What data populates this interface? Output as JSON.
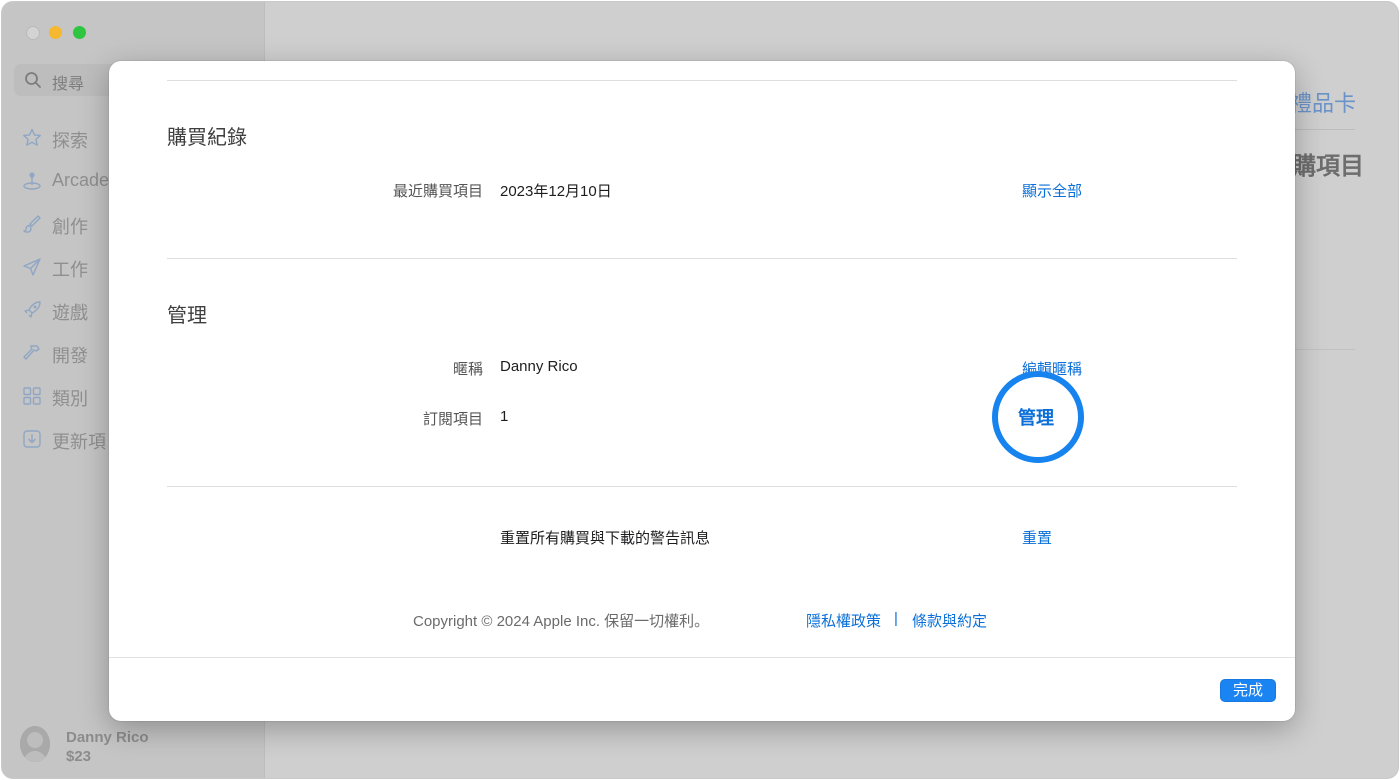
{
  "sidebar": {
    "search_placeholder": "搜尋",
    "items": [
      {
        "label": "探索",
        "icon": "star-icon"
      },
      {
        "label": "Arcade",
        "icon": "joystick-icon"
      },
      {
        "label": "創作",
        "icon": "paintbrush-icon"
      },
      {
        "label": "工作",
        "icon": "paper-plane-icon"
      },
      {
        "label": "遊戲",
        "icon": "rocket-icon"
      },
      {
        "label": "開發",
        "icon": "hammer-icon"
      },
      {
        "label": "類別",
        "icon": "grid-icon"
      },
      {
        "label": "更新項",
        "icon": "download-icon"
      }
    ],
    "user": {
      "name": "Danny Rico",
      "balance": "$23"
    }
  },
  "background": {
    "link": "禮品卡",
    "heading": "購項目"
  },
  "sheet": {
    "purchase": {
      "title": "購買紀錄",
      "recent_label": "最近購買項目",
      "recent_value": "2023年12月10日",
      "show_all": "顯示全部"
    },
    "manage": {
      "title": "管理",
      "nickname_label": "暱稱",
      "nickname_value": "Danny Rico",
      "edit_nickname": "編輯暱稱",
      "subscriptions_label": "訂閱項目",
      "subscriptions_value": "1",
      "manage_link": "管理"
    },
    "reset": {
      "label": "重置所有購買與下載的警告訊息",
      "button": "重置"
    },
    "footer": {
      "copyright": "Copyright © 2024 Apple Inc. 保留一切權利。",
      "privacy": "隱私權政策",
      "separator": "|",
      "terms": "條款與約定"
    },
    "done_button": "完成"
  }
}
